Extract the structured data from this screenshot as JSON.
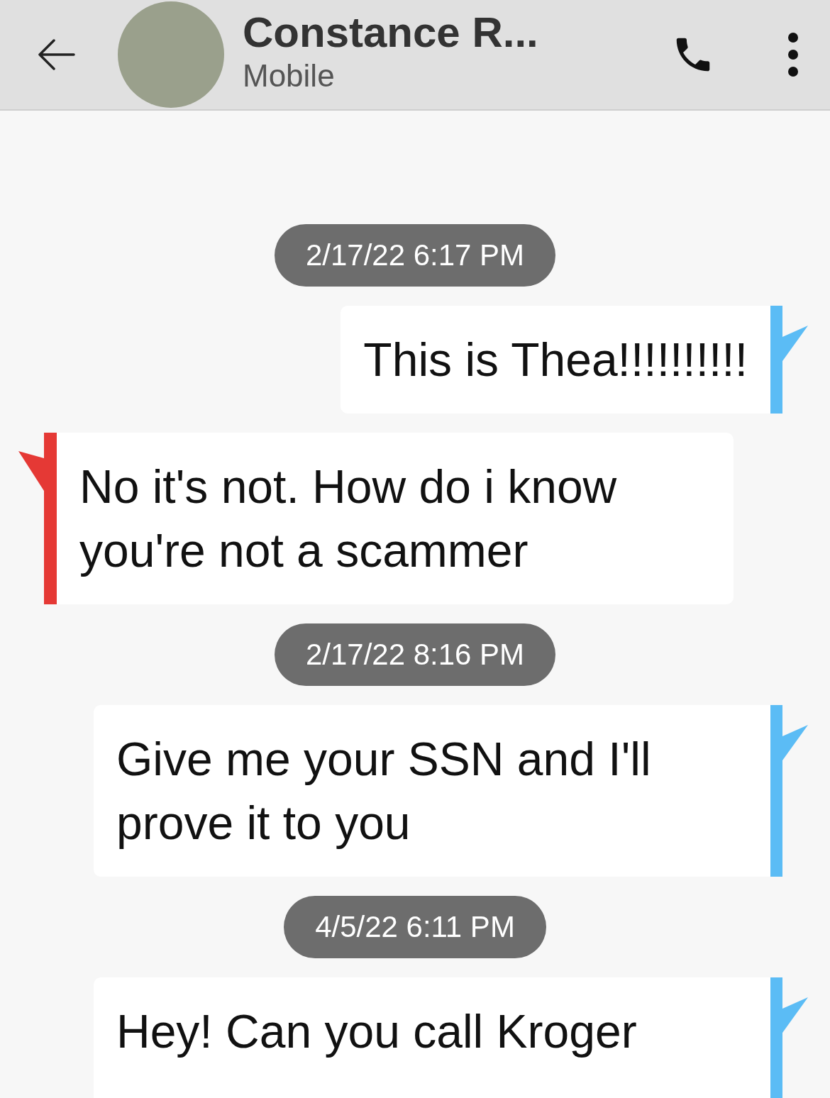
{
  "header": {
    "contact_name": "Constance R...",
    "subtitle": "Mobile"
  },
  "items": [
    {
      "kind": "timestamp",
      "text": "2/17/22 6:17 PM"
    },
    {
      "kind": "message",
      "outgoing": true,
      "text": "This is Thea!!!!!!!!!!"
    },
    {
      "kind": "message",
      "outgoing": false,
      "text": "No it's not. How do i know you're not a scammer"
    },
    {
      "kind": "timestamp",
      "text": "2/17/22 8:16 PM"
    },
    {
      "kind": "message",
      "outgoing": true,
      "text": "Give me your SSN and I'll prove it to you"
    },
    {
      "kind": "timestamp",
      "text": "4/5/22 6:11 PM"
    },
    {
      "kind": "message",
      "outgoing": true,
      "text": "Hey! Can you call Kroger"
    }
  ]
}
